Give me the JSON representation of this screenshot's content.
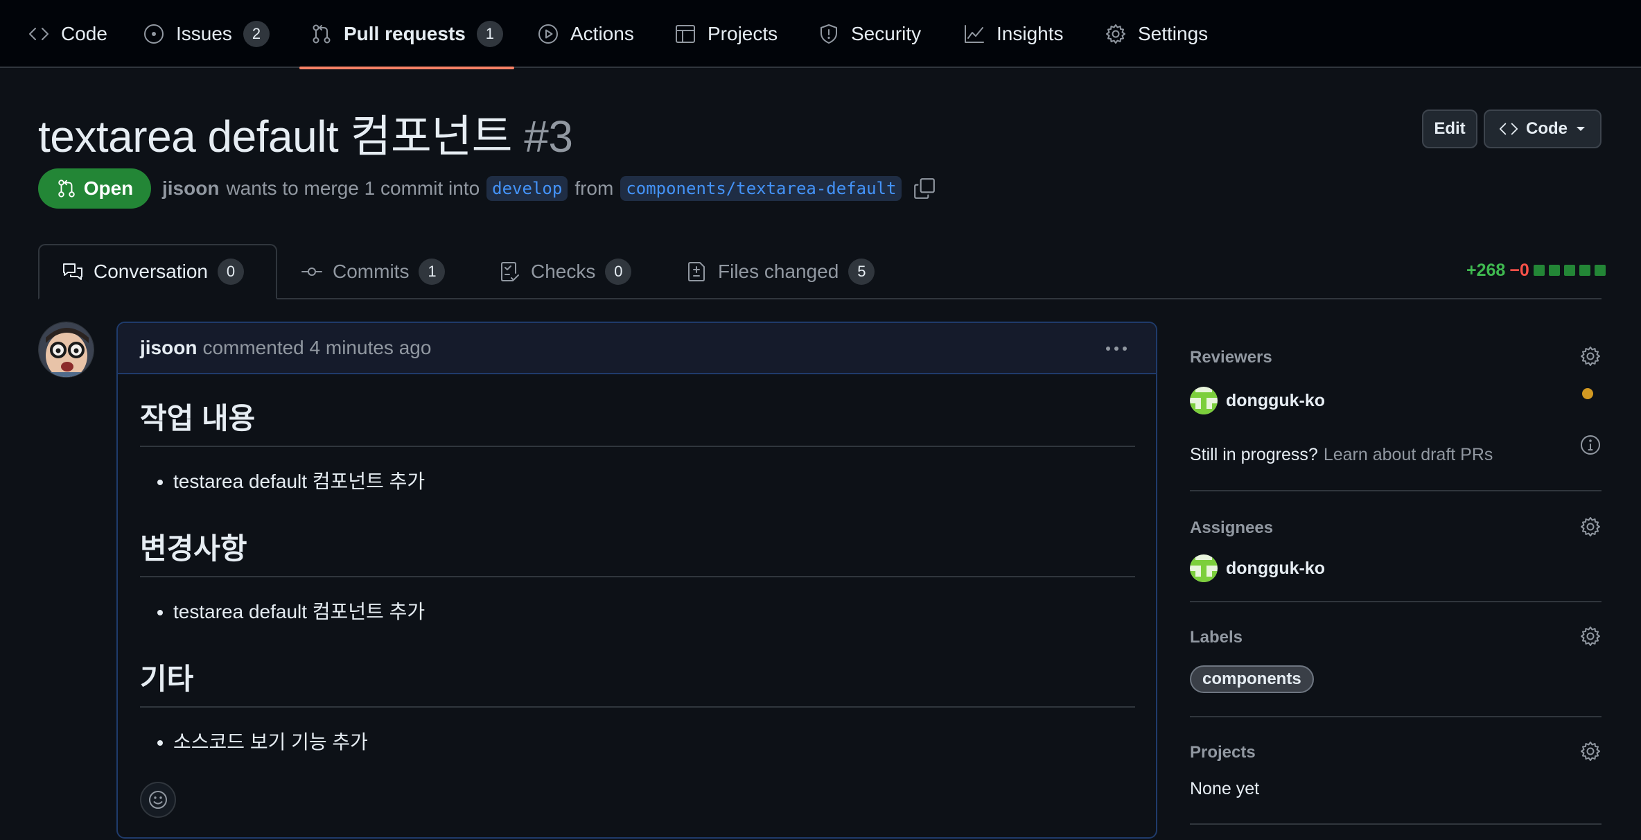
{
  "nav": {
    "items": [
      {
        "label": "Code",
        "icon": "code-icon"
      },
      {
        "label": "Issues",
        "count": "2",
        "icon": "issue-opened-icon"
      },
      {
        "label": "Pull requests",
        "count": "1",
        "icon": "git-pull-request-icon",
        "active": true
      },
      {
        "label": "Actions",
        "icon": "play-icon"
      },
      {
        "label": "Projects",
        "icon": "table-icon"
      },
      {
        "label": "Security",
        "icon": "shield-icon"
      },
      {
        "label": "Insights",
        "icon": "graph-icon"
      },
      {
        "label": "Settings",
        "icon": "gear-icon"
      }
    ]
  },
  "header": {
    "title": "textarea default 컴포넌트",
    "number": "#3",
    "edit_label": "Edit",
    "code_label": "Code",
    "state": "Open",
    "author": "jisoon",
    "merge_text_1": "wants to merge 1 commit into",
    "base_branch": "develop",
    "merge_text_2": "from",
    "head_branch": "components/textarea-default"
  },
  "tabs": [
    {
      "label": "Conversation",
      "count": "0"
    },
    {
      "label": "Commits",
      "count": "1"
    },
    {
      "label": "Checks",
      "count": "0"
    },
    {
      "label": "Files changed",
      "count": "5"
    }
  ],
  "diffstat": {
    "additions": "+268",
    "deletions": "−0",
    "add_color": "#3fb950",
    "del_color": "#f85149"
  },
  "comment": {
    "author": "jisoon",
    "meta": "commented 4 minutes ago",
    "sections": [
      {
        "heading": "작업 내용",
        "items": [
          "testarea default 컴포넌트 추가"
        ]
      },
      {
        "heading": "변경사항",
        "items": [
          "testarea default 컴포넌트 추가"
        ]
      },
      {
        "heading": "기타",
        "items": [
          "소스코드 보기 기능 추가"
        ]
      }
    ]
  },
  "sidebar": {
    "reviewers": {
      "title": "Reviewers",
      "users": [
        "dongguk-ko"
      ],
      "status_color": "#d29922"
    },
    "draft": {
      "question": "Still in progress?",
      "link": "Learn about draft PRs"
    },
    "assignees": {
      "title": "Assignees",
      "users": [
        "dongguk-ko"
      ]
    },
    "labels": {
      "title": "Labels",
      "items": [
        "components"
      ]
    },
    "projects": {
      "title": "Projects",
      "value": "None yet"
    }
  },
  "colors": {
    "accent_underline": "#f78166",
    "open_badge": "#238636",
    "link": "#4493f8"
  }
}
